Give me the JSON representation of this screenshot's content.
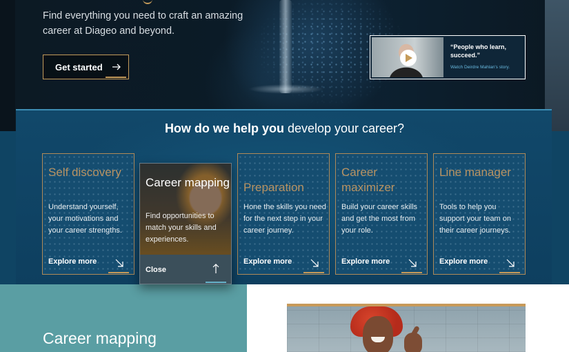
{
  "hero": {
    "tagline": "Find everything you need to craft an amazing career at Diageo and beyond.",
    "cta_label": "Get started",
    "video": {
      "quote": "“People who learn, succeed.”",
      "link": "Watch Deirdre Mahlan's story."
    }
  },
  "help": {
    "title_bold": "How do we help you",
    "title_rest": " develop your career?",
    "cards": [
      {
        "title": "Self discovery",
        "desc": "Understand yourself, your motivations and your career strengths.",
        "link": "Explore more"
      },
      {
        "title": "Career mapping",
        "desc": "Find opportunities to match your skills and experiences.",
        "link": "Close"
      },
      {
        "title": "Preparation",
        "desc": "Hone the skills you need for the next step in your career journey.",
        "link": "Explore more"
      },
      {
        "title": "Career maximizer",
        "desc": "Build your career skills and get the most from your role.",
        "link": "Explore more"
      },
      {
        "title": "Line manager",
        "desc": "Tools to help you support your team on their career journeys.",
        "link": "Explore more"
      }
    ]
  },
  "lower": {
    "title": "Career mapping"
  },
  "colors": {
    "accent_gold": "#c59b5a",
    "panel_blue": "#11486a",
    "teal": "#5a9ea3"
  }
}
